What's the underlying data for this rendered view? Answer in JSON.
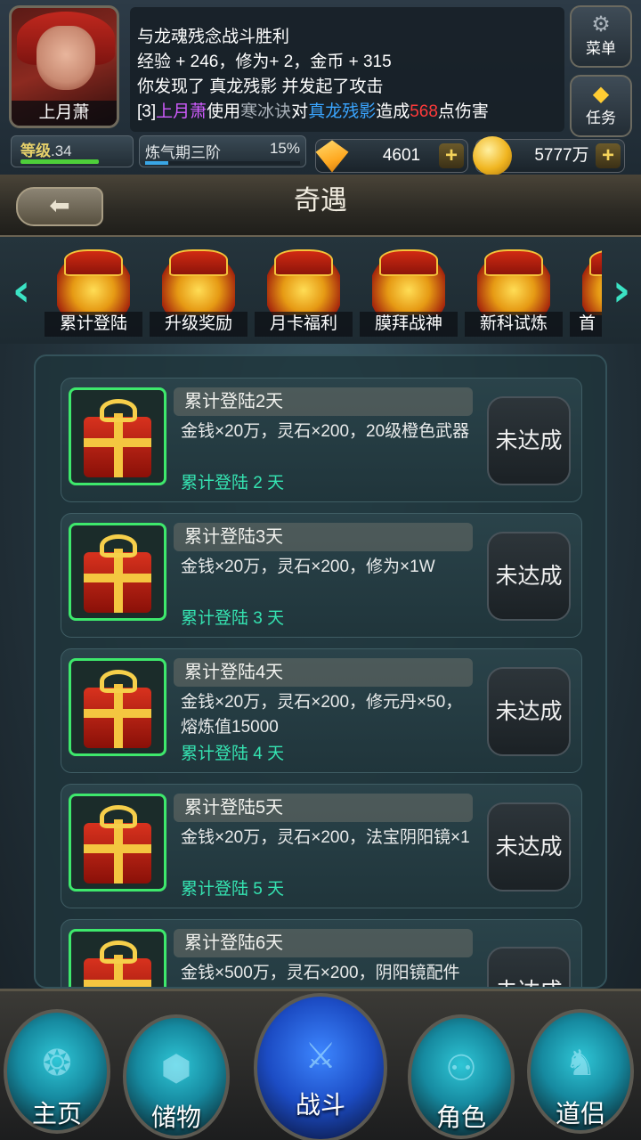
{
  "player": {
    "name": "上月萧",
    "level_label": "等级",
    "level_value": ".34",
    "cultivation": "炼气期三阶",
    "cultivation_pct": "15%",
    "cultivation_progress": 0.15
  },
  "log": {
    "line1": "与龙魂残念战斗胜利",
    "line2": "经验 + 246，修为+ 2，金币 + 315",
    "line3": "你发现了 真龙残影 并发起了攻击",
    "line4": {
      "prefix": "[3]",
      "actor": "上月萧",
      "verb1": "使用",
      "skill": "寒冰诀",
      "verb2": "对",
      "target": "真龙残影",
      "verb3": "造成",
      "damage": "568",
      "suffix": "点伤害"
    }
  },
  "side_buttons": {
    "menu": "菜单",
    "quest": "任务"
  },
  "resources": {
    "gems": "4601",
    "gold": "5777万",
    "plus": "+"
  },
  "page": {
    "title": "奇遇",
    "back_icon": "left-arrow"
  },
  "tabs": [
    {
      "label": "累计登陆"
    },
    {
      "label": "升级奖励"
    },
    {
      "label": "月卡福利"
    },
    {
      "label": "膜拜战神"
    },
    {
      "label": "新科试炼"
    },
    {
      "label": "首"
    }
  ],
  "arrows": {
    "left": "‹",
    "right": "›"
  },
  "rewards": [
    {
      "title": "累计登陆2天",
      "desc": "金钱×20万，灵石×200，20级橙色武器",
      "progress": "累计登陆 2 天",
      "status": "未达成"
    },
    {
      "title": "累计登陆3天",
      "desc": "金钱×20万，灵石×200，修为×1W",
      "progress": "累计登陆 3 天",
      "status": "未达成"
    },
    {
      "title": "累计登陆4天",
      "desc": "金钱×20万，灵石×200，修元丹×50，熔炼值15000",
      "progress": "累计登陆 4 天",
      "status": "未达成"
    },
    {
      "title": "累计登陆5天",
      "desc": "金钱×20万，灵石×200，法宝阴阳镜×1",
      "progress": "累计登陆 5 天",
      "status": "未达成"
    },
    {
      "title": "累计登陆6天",
      "desc": "金钱×500万，灵石×200，阴阳镜配件",
      "progress": "",
      "status": "未达成"
    }
  ],
  "nav": [
    {
      "label": "主页"
    },
    {
      "label": "储物"
    },
    {
      "label": "战斗"
    },
    {
      "label": "角色"
    },
    {
      "label": "道侣"
    }
  ],
  "colors": {
    "progress_text": "#35e3b1",
    "gift_frame": "#3ee86c",
    "log_actor": "#d15cff",
    "log_target": "#3aa5ff",
    "log_damage": "#ff3a3a",
    "arrow": "#3be3c4"
  }
}
